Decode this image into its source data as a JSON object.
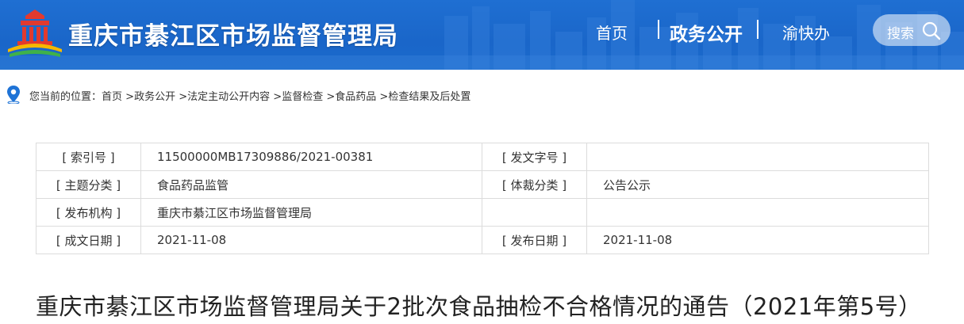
{
  "header": {
    "site_title": "重庆市綦江区市场监督管理局",
    "nav": [
      {
        "label": "首页"
      },
      {
        "label": "政务公开"
      },
      {
        "label": "渝快办"
      }
    ],
    "search_label": "搜索"
  },
  "breadcrumb": {
    "prefix": "您当前的位置：",
    "items": [
      "首页",
      "政务公开",
      "法定主动公开内容",
      "监督检查",
      "食品药品",
      "检查结果及后处置"
    ]
  },
  "meta": {
    "rows": [
      {
        "k1": "[ 索引号 ]",
        "v1": "11500000MB17309886/2021-00381",
        "k2": "[ 发文字号 ]",
        "v2": ""
      },
      {
        "k1": "[ 主题分类 ]",
        "v1": "食品药品监管",
        "k2": "[ 体裁分类 ]",
        "v2": "公告公示"
      },
      {
        "k1": "[ 发布机构 ]",
        "v1": "重庆市綦江区市场监督管理局",
        "k2": "",
        "v2": ""
      },
      {
        "k1": "[ 成文日期 ]",
        "v1": "2021-11-08",
        "k2": "[ 发布日期 ]",
        "v2": "2021-11-08"
      }
    ]
  },
  "article": {
    "title": "重庆市綦江区市场监督管理局关于2批次食品抽检不合格情况的通告（2021年第5号）"
  },
  "colors": {
    "header_blue": "#1b6acb",
    "pin_blue": "#1e73d6",
    "border": "#dcdcdc"
  },
  "icons": [
    "logo-emblem-icon",
    "search-icon",
    "location-pin-icon"
  ]
}
